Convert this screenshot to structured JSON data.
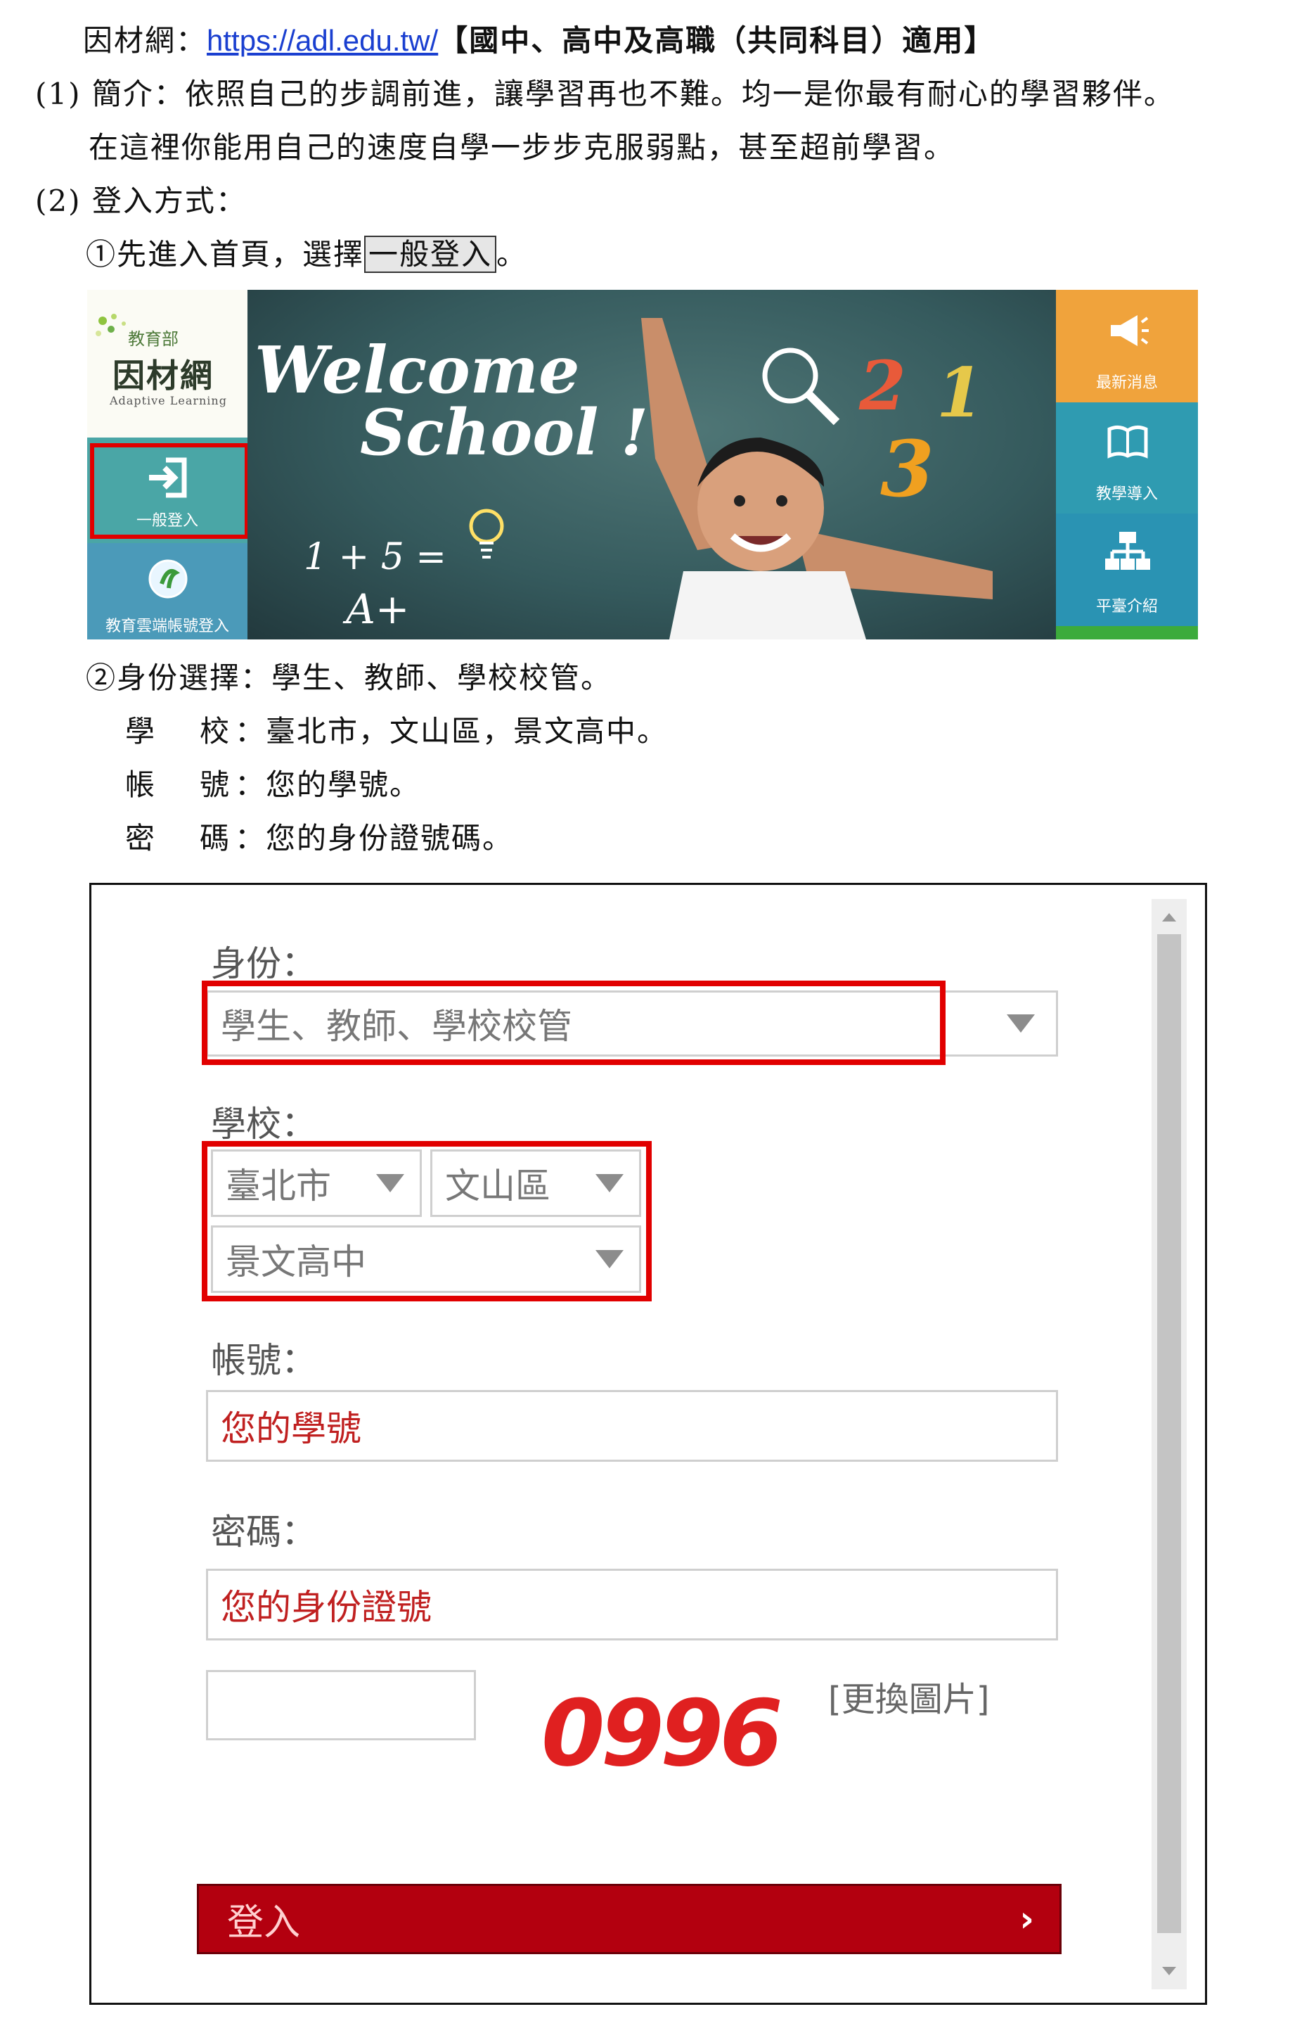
{
  "doc": {
    "line1": {
      "prefix": "因材網：",
      "url": "https://adl.edu.tw/",
      "suffix": "【國中、高中及高職（共同科目）適用】"
    },
    "section1": {
      "marker": "(1)",
      "text": "簡介：依照自己的步調前進，讓學習再也不難。均一是你最有耐心的學習夥伴。",
      "text2": "在這裡你能用自己的速度自學一步步克服弱點，甚至超前學習。"
    },
    "section2": {
      "marker": "(2)",
      "text": "登入方式："
    },
    "step1": {
      "prefix": "①先進入首頁，選擇",
      "boxed": "一般登入",
      "suffix": "。"
    },
    "step2": {
      "text": "②身份選擇：學生、教師、學校校管。"
    },
    "info": [
      {
        "label": "學　校",
        "value": "：臺北市，文山區，景文高中。"
      },
      {
        "label": "帳　號",
        "value": "：您的學號。"
      },
      {
        "label": "密　碼",
        "value": "：您的身份證號碼。"
      }
    ]
  },
  "banner": {
    "brand_moe": "教育部",
    "brand_name": "因材網",
    "brand_eng": "Adaptive Learning",
    "general_login": "一般登入",
    "cloud_login": "教育雲端帳號登入",
    "welcome": "Welcome",
    "school": "School !",
    "chalk_math": "1 + 5 =",
    "chalk_grade": "A+",
    "chalk_nums": [
      "2",
      "1",
      "3"
    ],
    "side": [
      {
        "label": "最新消息",
        "color": "#f0a33c",
        "icon": "megaphone-icon"
      },
      {
        "label": "教學導入",
        "color": "#2f9bb1",
        "icon": "book-icon"
      },
      {
        "label": "平臺介紹",
        "color": "#2a93b3",
        "icon": "sitemap-icon"
      }
    ],
    "colors": {
      "highlight": "#e10000"
    }
  },
  "form": {
    "identity_label": "身份：",
    "identity_value": "學生、教師、學校校管",
    "school_label": "學校：",
    "city": "臺北市",
    "district": "文山區",
    "school": "景文高中",
    "account_label": "帳號：",
    "account_placeholder": "您的學號",
    "password_label": "密碼：",
    "password_placeholder": "您的身份證號",
    "captcha_value": "0996",
    "change_image": "[更換圖片]",
    "login_button": "登入",
    "login_chevron": "›"
  }
}
